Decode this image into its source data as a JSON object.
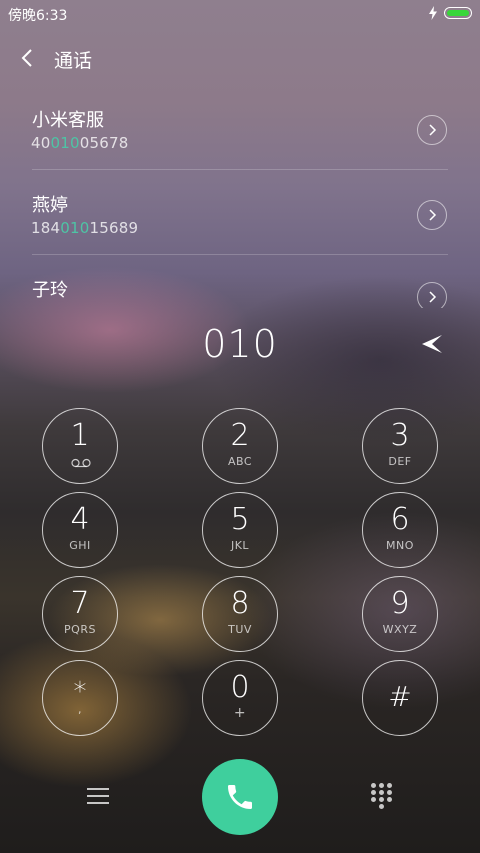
{
  "status": {
    "time": "傍晚6:33"
  },
  "header": {
    "title": "通话"
  },
  "contacts": [
    {
      "name": "小米客服",
      "number_pre": "40",
      "number_match": "010",
      "number_post": "05678"
    },
    {
      "name": "燕婷",
      "number_pre": "184",
      "number_match": "010",
      "number_post": "15689"
    },
    {
      "name": "子玲",
      "number_pre": "",
      "number_match": "",
      "number_post": ""
    }
  ],
  "dialer": {
    "number": "010",
    "keys": [
      {
        "digit": "1",
        "sub": ""
      },
      {
        "digit": "2",
        "sub": "ABC"
      },
      {
        "digit": "3",
        "sub": "DEF"
      },
      {
        "digit": "4",
        "sub": "GHI"
      },
      {
        "digit": "5",
        "sub": "JKL"
      },
      {
        "digit": "6",
        "sub": "MNO"
      },
      {
        "digit": "7",
        "sub": "PQRS"
      },
      {
        "digit": "8",
        "sub": "TUV"
      },
      {
        "digit": "9",
        "sub": "WXYZ"
      },
      {
        "digit": "*",
        "sub": ","
      },
      {
        "digit": "0",
        "sub": "+"
      },
      {
        "digit": "#",
        "sub": ""
      }
    ]
  },
  "icons": {
    "charging": "bolt-icon",
    "battery": "battery-icon",
    "back": "chevron-left-icon",
    "contact_detail": "chevron-right-icon",
    "delete": "backspace-icon",
    "voicemail": "voicemail-icon",
    "menu": "menu-icon",
    "call": "phone-icon",
    "keypad": "keypad-icon"
  },
  "colors": {
    "accent": "#3fcf9d",
    "match_highlight": "#4ec4a5",
    "battery": "#38d63a"
  }
}
